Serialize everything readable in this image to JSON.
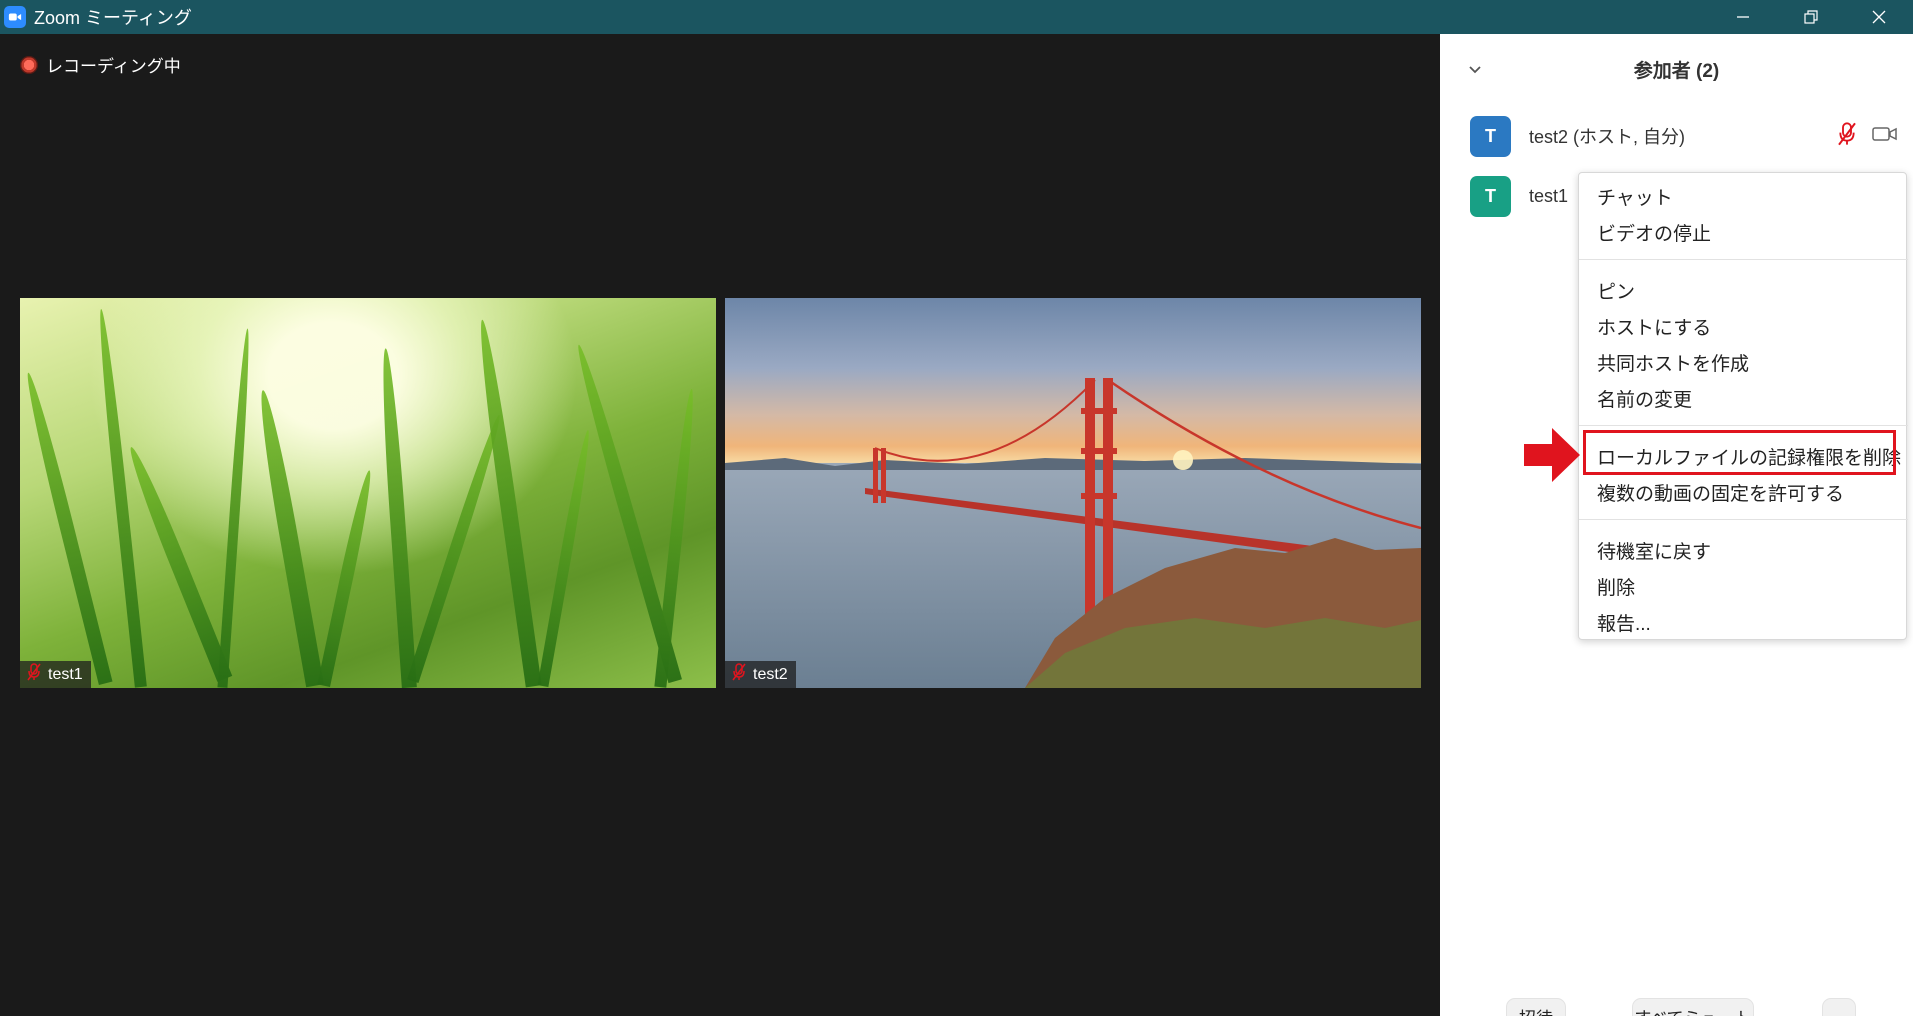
{
  "window": {
    "title": "Zoom ミーティング",
    "icon": "zoom-camera-icon",
    "controls": [
      "minimize-icon",
      "restore-icon",
      "close-icon"
    ]
  },
  "video": {
    "recording_label": "レコーディング中",
    "tiles": [
      {
        "name": "test1",
        "background": "grass",
        "muted": true
      },
      {
        "name": "test2",
        "background": "golden-gate-bridge",
        "muted": true
      }
    ]
  },
  "participants_panel": {
    "title": "参加者 (2)",
    "participants": [
      {
        "initial": "T",
        "name": "test2 (ホスト, 自分)",
        "avatar_color": "#2b79c2",
        "mic": "muted",
        "video": "on"
      },
      {
        "initial": "T",
        "name": "test1",
        "avatar_color": "#18a085"
      }
    ],
    "buttons": {
      "invite": "招待",
      "mute_all": "すべてミュート",
      "more": "..."
    }
  },
  "context_menu": {
    "groups": [
      [
        "チャット",
        "ビデオの停止"
      ],
      [
        "ピン",
        "ホストにする",
        "共同ホストを作成",
        "名前の変更"
      ],
      [
        "ローカルファイルの記録権限を削除",
        "複数の動画の固定を許可する"
      ],
      [
        "待機室に戻す",
        "削除",
        "報告..."
      ]
    ],
    "highlighted_item": "ローカルファイルの記録権限を削除",
    "highlight_color": "#e0141e"
  },
  "colors": {
    "titlebar": "#1b5560",
    "video_bg": "#1a1a1a",
    "panel_bg": "#ffffff",
    "muted_red": "#e0141e"
  }
}
